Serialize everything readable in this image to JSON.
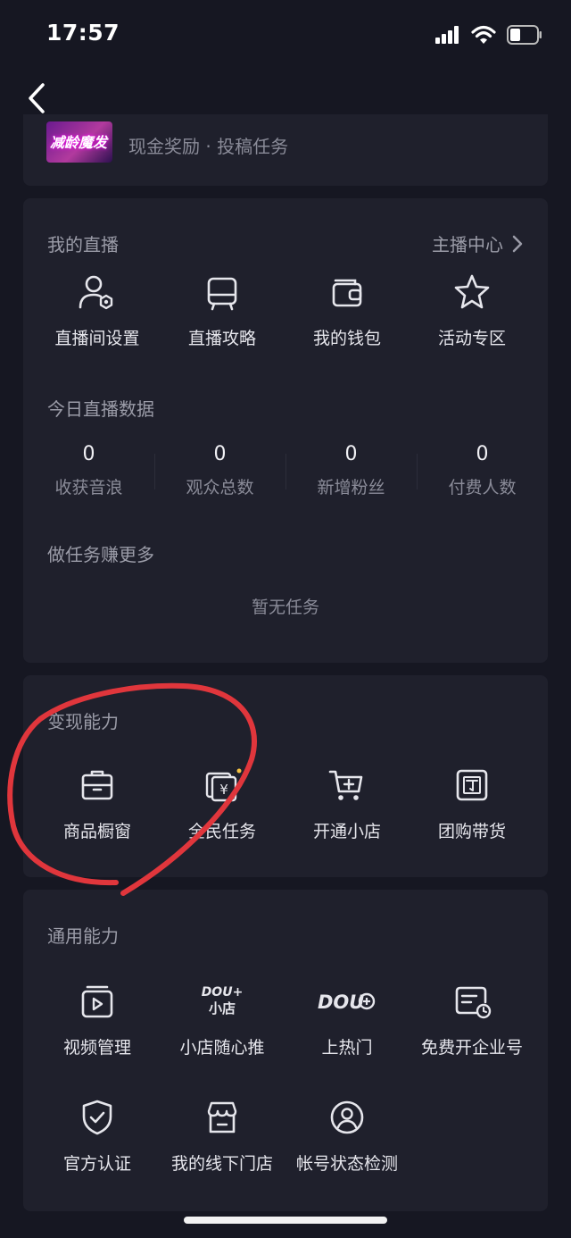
{
  "status_bar": {
    "time": "17:57"
  },
  "promo": {
    "thumb_text": "减龄魔发",
    "subtitle": "现金奖励 · 投稿任务"
  },
  "live": {
    "title": "我的直播",
    "center_link": "主播中心",
    "tools": [
      {
        "label": "直播间设置",
        "icon": "user-settings-icon"
      },
      {
        "label": "直播攻略",
        "icon": "guide-icon"
      },
      {
        "label": "我的钱包",
        "icon": "wallet-icon"
      },
      {
        "label": "活动专区",
        "icon": "star-icon"
      }
    ],
    "stats_title": "今日直播数据",
    "stats": [
      {
        "value": "0",
        "label": "收获音浪"
      },
      {
        "value": "0",
        "label": "观众总数"
      },
      {
        "value": "0",
        "label": "新增粉丝"
      },
      {
        "value": "0",
        "label": "付费人数"
      }
    ],
    "tasks_title": "做任务赚更多",
    "tasks_empty": "暂无任务"
  },
  "monetize": {
    "title": "变现能力",
    "items": [
      {
        "label": "商品橱窗",
        "icon": "shop-window-icon"
      },
      {
        "label": "全民任务",
        "icon": "task-cards-icon"
      },
      {
        "label": "开通小店",
        "icon": "cart-plus-icon"
      },
      {
        "label": "团购带货",
        "icon": "group-buy-icon"
      }
    ]
  },
  "general": {
    "title": "通用能力",
    "items": [
      {
        "label": "视频管理",
        "icon": "video-manage-icon"
      },
      {
        "label": "小店随心推",
        "icon": "dou-plus-shop-icon",
        "logo_text": [
          "DOU+",
          "小店"
        ]
      },
      {
        "label": "上热门",
        "icon": "dou-hot-icon",
        "logo_text": "DOU"
      },
      {
        "label": "免费开企业号",
        "icon": "enterprise-icon"
      },
      {
        "label": "官方认证",
        "icon": "shield-check-icon"
      },
      {
        "label": "我的线下门店",
        "icon": "store-icon"
      },
      {
        "label": "帐号状态检测",
        "icon": "account-check-icon"
      }
    ]
  },
  "colors": {
    "background": "#161722",
    "card": "#1f202c",
    "annotation": "#e0363c"
  }
}
